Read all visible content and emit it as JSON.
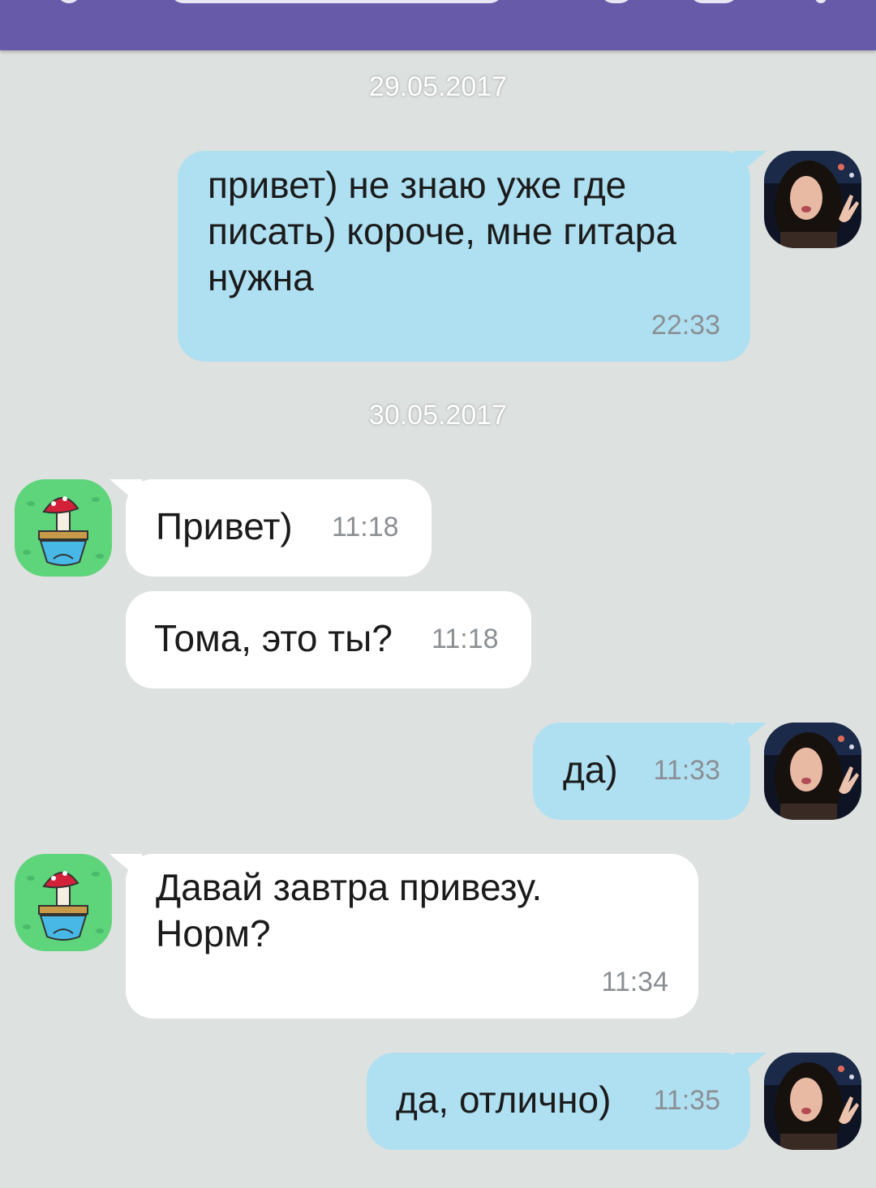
{
  "colors": {
    "header": "#675aa9",
    "background": "#dde1df",
    "outgoing_bubble": "#aee0f2",
    "incoming_bubble": "#ffffff",
    "time_text": "#8b8f93"
  },
  "chat": {
    "dates": [
      "29.05.2017",
      "30.05.2017"
    ],
    "messages": [
      {
        "direction": "out",
        "text": "привет) не знаю уже где\nписать) короче, мне гитара\nнужна",
        "time": "22:33",
        "avatar": "user-photo-avatar"
      },
      {
        "direction": "in",
        "text": "Привет)",
        "time": "11:18",
        "avatar": "mushroom-sticker-avatar"
      },
      {
        "direction": "in",
        "text": "Тома, это ты?",
        "time": "11:18"
      },
      {
        "direction": "out",
        "text": "да)",
        "time": "11:33",
        "avatar": "user-photo-avatar"
      },
      {
        "direction": "in",
        "text": "Давай завтра привезу.\nНорм?",
        "time": "11:34",
        "avatar": "mushroom-sticker-avatar"
      },
      {
        "direction": "out",
        "text": "да, отлично)",
        "time": "11:35",
        "avatar": "user-photo-avatar"
      }
    ]
  }
}
